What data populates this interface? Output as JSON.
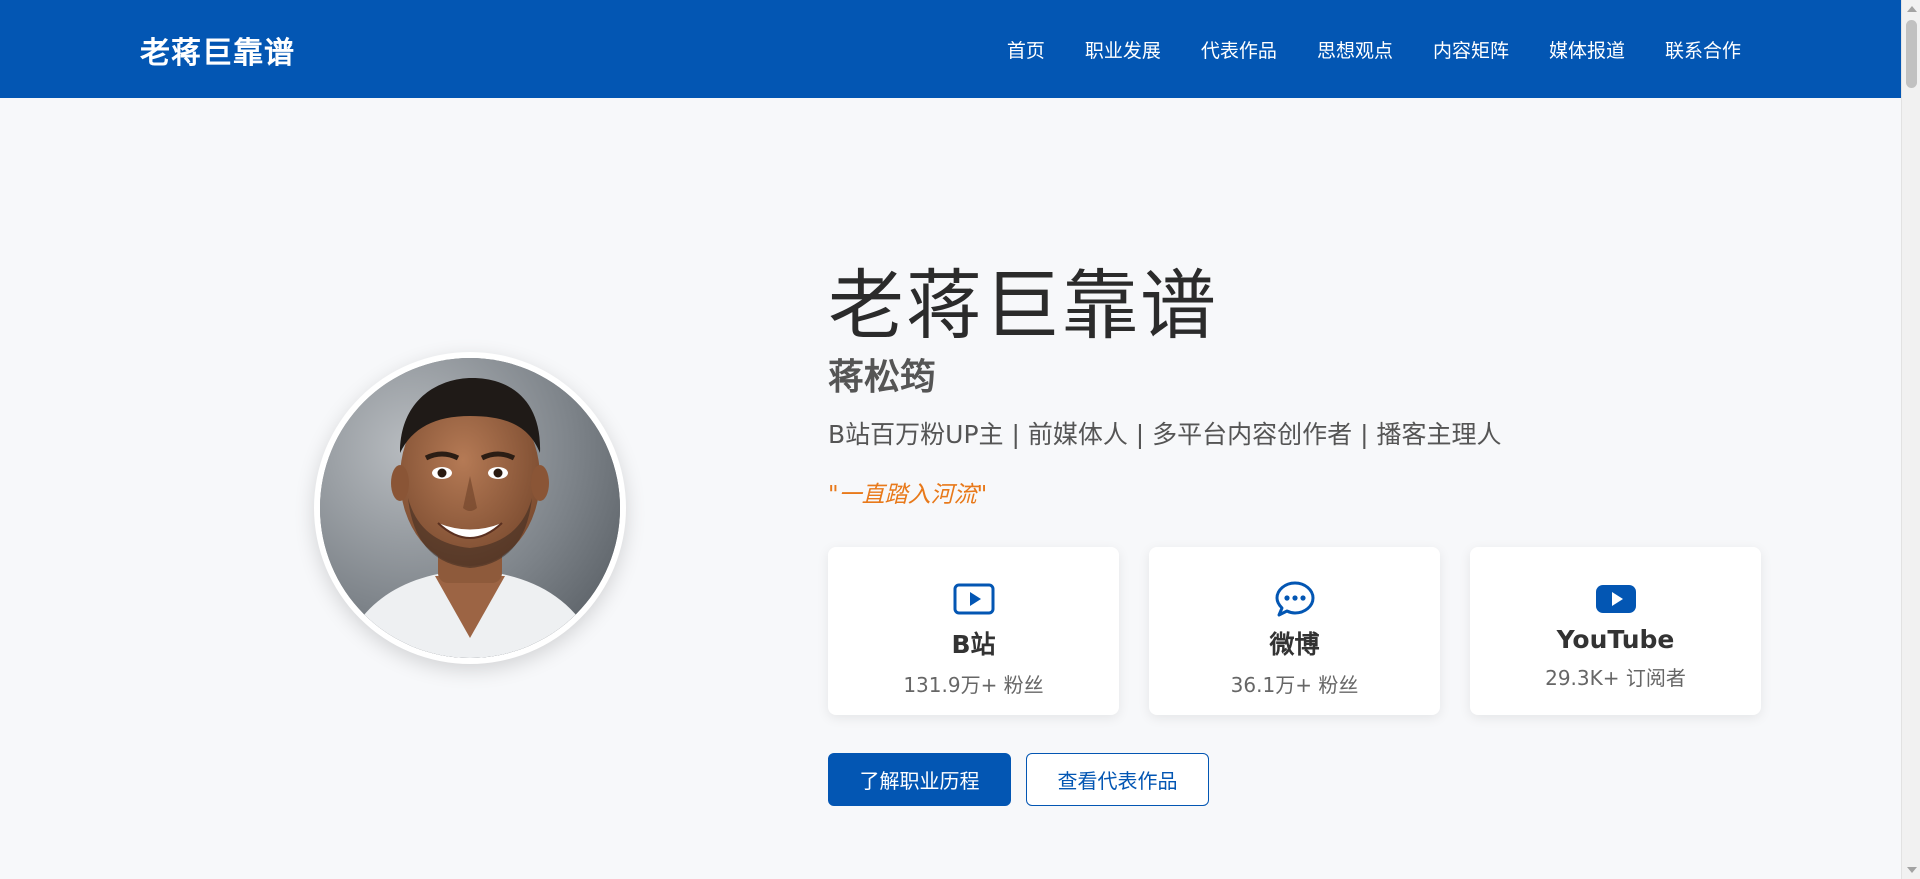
{
  "brand": "老蒋巨靠谱",
  "nav": {
    "items": [
      "首页",
      "职业发展",
      "代表作品",
      "思想观点",
      "内容矩阵",
      "媒体报道",
      "联系合作"
    ]
  },
  "hero": {
    "title": "老蒋巨靠谱",
    "name": "蒋松筠",
    "tagline": "B站百万粉UP主 | 前媒体人 | 多平台内容创作者 | 播客主理人",
    "quote": "\"一直踏入河流\""
  },
  "platforms": [
    {
      "icon": "video-play-icon",
      "name": "B站",
      "count": "131.9万+ 粉丝"
    },
    {
      "icon": "chat-bubble-icon",
      "name": "微博",
      "count": "36.1万+ 粉丝"
    },
    {
      "icon": "youtube-icon",
      "name": "YouTube",
      "count": "29.3K+ 订阅者"
    }
  ],
  "buttons": {
    "primary": "了解职业历程",
    "secondary": "查看代表作品"
  },
  "colors": {
    "brand_blue": "#0356b3",
    "accent_orange": "#e8791a",
    "background": "#f7f8fa"
  }
}
